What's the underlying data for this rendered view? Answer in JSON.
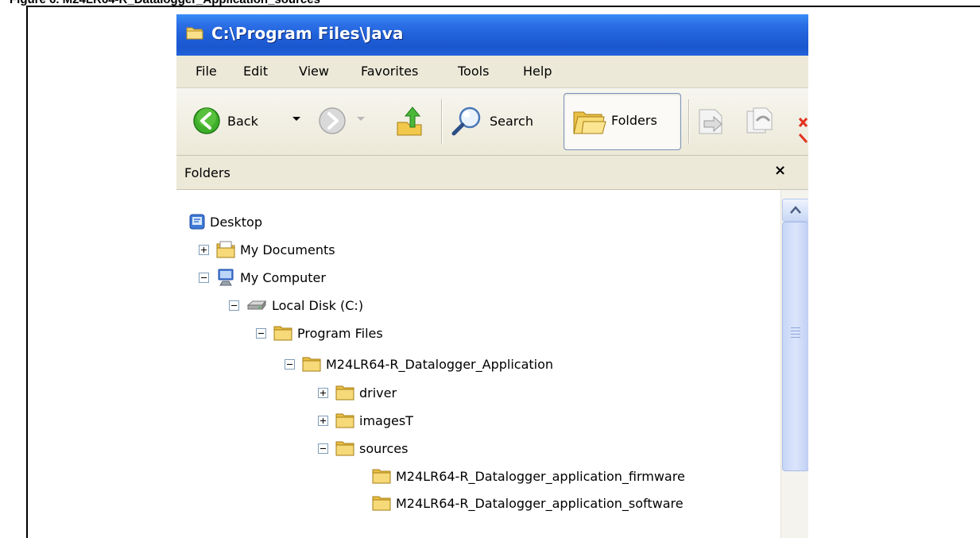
{
  "caption": "Figure 6. M24LR64-R_Datalogger_Application_sources",
  "window": {
    "title": "C:\\Program Files\\Java",
    "menu": [
      "File",
      "Edit",
      "View",
      "Favorites",
      "Tools",
      "Help"
    ],
    "toolbar": {
      "back_label": "Back",
      "search_label": "Search",
      "folders_label": "Folders"
    },
    "folders_pane": {
      "title": "Folders",
      "close_label": "×"
    },
    "tree": [
      {
        "label": "Desktop"
      },
      {
        "label": "My Documents"
      },
      {
        "label": "My Computer"
      },
      {
        "label": "Local Disk (C:)"
      },
      {
        "label": "Program Files"
      },
      {
        "label": "M24LR64-R_Datalogger_Application"
      },
      {
        "label": "driver"
      },
      {
        "label": "imagesT"
      },
      {
        "label": "sources"
      },
      {
        "label": "M24LR64-R_Datalogger_application_firmware"
      },
      {
        "label": "M24LR64-R_Datalogger_application_software"
      }
    ]
  },
  "colors": {
    "titlebar": "#1f5fd8",
    "chrome": "#ece9d8",
    "folder": "#f2d36b",
    "scroll_thumb": "#c7d5f7"
  },
  "icons": [
    "folder-icon",
    "back-icon",
    "forward-icon",
    "up-icon",
    "search-icon",
    "folders-icon",
    "desktop-icon",
    "my-documents-icon",
    "my-computer-icon",
    "local-disk-icon",
    "move-to-icon",
    "copy-to-icon"
  ]
}
